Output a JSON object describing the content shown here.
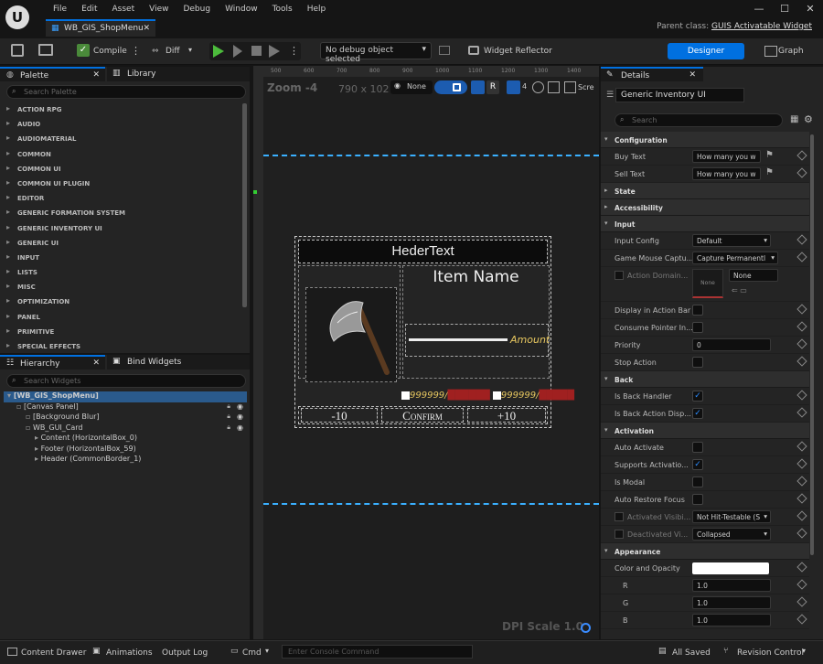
{
  "app": {
    "menu": [
      "File",
      "Edit",
      "Asset",
      "View",
      "Debug",
      "Window",
      "Tools",
      "Help"
    ],
    "tab_title": "WB_GIS_ShopMenu",
    "parent_class_label": "Parent class:",
    "parent_class": "GUIS Activatable Widget"
  },
  "toolbar": {
    "compile": "Compile",
    "diff": "Diff",
    "debug_object": "No debug object selected",
    "widget_reflector": "Widget Reflector",
    "designer": "Designer",
    "graph": "Graph"
  },
  "palette": {
    "tab": "Palette",
    "library_tab": "Library",
    "search_placeholder": "Search Palette",
    "categories": [
      "ACTION RPG",
      "AUDIO",
      "AUDIOMATERIAL",
      "COMMON",
      "COMMON UI",
      "COMMON UI PLUGIN",
      "EDITOR",
      "GENERIC FORMATION SYSTEM",
      "GENERIC INVENTORY UI",
      "GENERIC UI",
      "INPUT",
      "LISTS",
      "MISC",
      "OPTIMIZATION",
      "PANEL",
      "PRIMITIVE",
      "SPECIAL EFFECTS"
    ]
  },
  "hierarchy": {
    "tab": "Hierarchy",
    "bind_tab": "Bind Widgets",
    "search_placeholder": "Search Widgets",
    "items": [
      {
        "label": "[WB_GIS_ShopMenu]",
        "indent": 0
      },
      {
        "label": "[Canvas Panel]",
        "indent": 1
      },
      {
        "label": "[Background Blur]",
        "indent": 2
      },
      {
        "label": "WB_GUI_Card",
        "indent": 2
      },
      {
        "label": "Content (HorizontalBox_0)",
        "indent": 3
      },
      {
        "label": "Footer (HorizontalBox_59)",
        "indent": 3
      },
      {
        "label": "Header (CommonBorder_1)",
        "indent": 3
      }
    ]
  },
  "canvas": {
    "zoom": "Zoom -4",
    "resolution": "790 x 102",
    "none": "None",
    "scale_btn": "4",
    "screen": "Scre",
    "ruler_marks": [
      "500",
      "600",
      "700",
      "800",
      "900",
      "1000",
      "1100",
      "1200",
      "1300",
      "1400",
      "1500",
      "1600"
    ],
    "dpi": "DPI Scale 1.0",
    "card": {
      "header": "HederText",
      "item_name": "Item Name",
      "amount": "Amount",
      "price1": "999999/",
      "price2": "999999/",
      "minus": "-10",
      "confirm": "Confirm",
      "plus": "+10"
    }
  },
  "details": {
    "tab": "Details",
    "widget_name": "Generic Inventory UI",
    "search_placeholder": "Search",
    "sections": [
      {
        "title": "Configuration",
        "open": true,
        "rows": [
          {
            "label": "Buy Text",
            "type": "text",
            "value": "How many you w"
          },
          {
            "label": "Sell Text",
            "type": "text",
            "value": "How many you w"
          }
        ]
      },
      {
        "title": "State",
        "open": false,
        "rows": []
      },
      {
        "title": "Accessibility",
        "open": false,
        "rows": []
      },
      {
        "title": "Input",
        "open": true,
        "rows": [
          {
            "label": "Input Config",
            "type": "combo",
            "value": "Default"
          },
          {
            "label": "Game Mouse Captu...",
            "type": "combo",
            "value": "Capture Permanentl"
          },
          {
            "label": "Action Domain...",
            "type": "domain",
            "value": "None",
            "sub": "None"
          },
          {
            "label": "Display in Action Bar",
            "type": "check",
            "value": false
          },
          {
            "label": "Consume Pointer In...",
            "type": "check",
            "value": false
          },
          {
            "label": "Priority",
            "type": "text",
            "value": "0"
          },
          {
            "label": "Stop Action",
            "type": "check",
            "value": false
          }
        ]
      },
      {
        "title": "Back",
        "open": true,
        "rows": [
          {
            "label": "Is Back Handler",
            "type": "check",
            "value": true
          },
          {
            "label": "Is Back Action Disp...",
            "type": "check",
            "value": true
          }
        ]
      },
      {
        "title": "Activation",
        "open": true,
        "rows": [
          {
            "label": "Auto Activate",
            "type": "check",
            "value": false
          },
          {
            "label": "Supports Activatio...",
            "type": "check",
            "value": true
          },
          {
            "label": "Is Modal",
            "type": "check",
            "value": false
          },
          {
            "label": "Auto Restore Focus",
            "type": "check",
            "value": false
          },
          {
            "label": "Activated Visibi...",
            "type": "combo",
            "value": "Not Hit-Testable (S"
          },
          {
            "label": "Deactivated Vi...",
            "type": "combo",
            "value": "Collapsed"
          }
        ]
      },
      {
        "title": "Appearance",
        "open": true,
        "rows": [
          {
            "label": "Color and Opacity",
            "type": "color",
            "value": ""
          },
          {
            "label": "R",
            "type": "text",
            "value": "1.0"
          },
          {
            "label": "G",
            "type": "text",
            "value": "1.0"
          },
          {
            "label": "B",
            "type": "text",
            "value": "1.0"
          }
        ]
      }
    ]
  },
  "bottom": {
    "content_drawer": "Content Drawer",
    "animations": "Animations",
    "output_log": "Output Log",
    "cmd": "Cmd",
    "console_placeholder": "Enter Console Command",
    "all_saved": "All Saved",
    "revision_control": "Revision Control"
  },
  "colors": {
    "accent": "#0070e0",
    "selection": "#2a5a8c",
    "amount": "#e8c860"
  }
}
